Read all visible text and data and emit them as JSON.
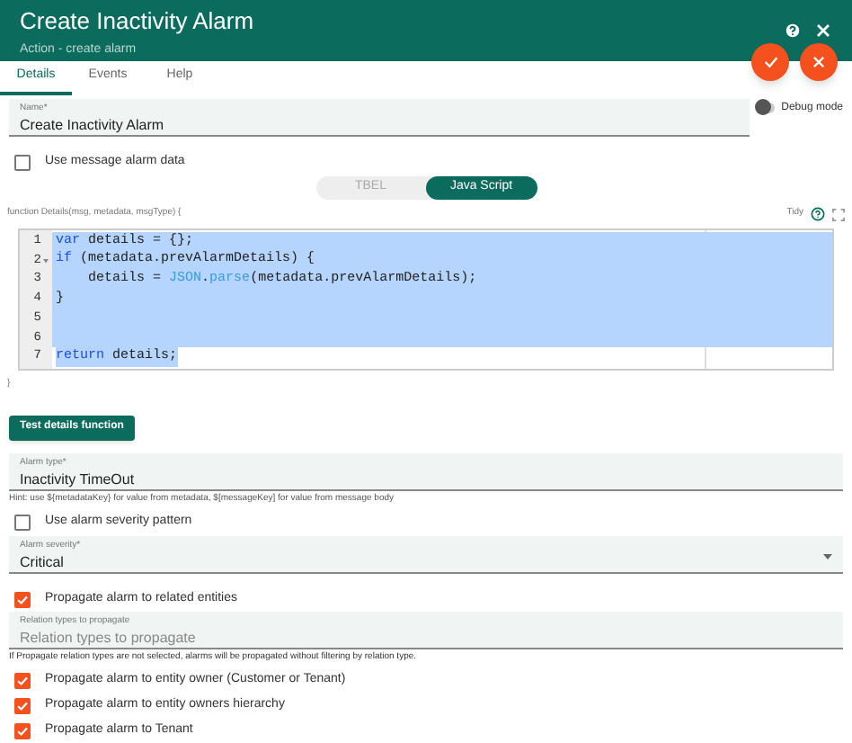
{
  "header": {
    "title": "Create Inactivity Alarm",
    "subtitle": "Action - create alarm"
  },
  "tabs": [
    {
      "label": "Details",
      "selected": true
    },
    {
      "label": "Events",
      "selected": false
    },
    {
      "label": "Help",
      "selected": false
    }
  ],
  "name_field": {
    "label": "Name*",
    "value": "Create Inactivity Alarm"
  },
  "debug_mode": {
    "label": "Debug mode",
    "on": false
  },
  "use_message_alarm_data": {
    "label": "Use message alarm data",
    "checked": false
  },
  "language_toggle": [
    {
      "label": "TBEL",
      "selected": false
    },
    {
      "label": "Java Script",
      "selected": true
    }
  ],
  "function_header": {
    "signature": "function Details(msg, metadata, msgType) {",
    "tidy": "Tidy"
  },
  "code_lines": [
    {
      "number": "1",
      "fold": false,
      "full_line_selected": true,
      "tokens": [
        {
          "text": "var",
          "kind": "keyword"
        },
        {
          "text": " details = {};",
          "kind": "plain"
        }
      ]
    },
    {
      "number": "2",
      "fold": true,
      "full_line_selected": true,
      "tokens": [
        {
          "text": "if",
          "kind": "keyword"
        },
        {
          "text": " (metadata.prevAlarmDetails) {",
          "kind": "plain"
        }
      ]
    },
    {
      "number": "3",
      "fold": false,
      "full_line_selected": true,
      "tokens": [
        {
          "text": "    details = ",
          "kind": "plain"
        },
        {
          "text": "JSON",
          "kind": "builtin"
        },
        {
          "text": ".",
          "kind": "plain"
        },
        {
          "text": "parse",
          "kind": "builtin"
        },
        {
          "text": "(metadata.prevAlarmDetails);",
          "kind": "plain"
        }
      ]
    },
    {
      "number": "4",
      "fold": false,
      "full_line_selected": true,
      "tokens": [
        {
          "text": "}",
          "kind": "plain"
        }
      ]
    },
    {
      "number": "5",
      "fold": false,
      "full_line_selected": true
    },
    {
      "number": "6",
      "fold": false,
      "full_line_selected": true
    },
    {
      "number": "7",
      "fold": false,
      "full_line_selected": false,
      "tokens": [
        {
          "text": "return",
          "kind": "keyword"
        },
        {
          "text": " details;",
          "kind": "plain"
        }
      ]
    }
  ],
  "function_footer": "}",
  "test_button": "Test details function",
  "alarm_type_field": {
    "label": "Alarm type*",
    "value": "Inactivity TimeOut"
  },
  "alarm_type_hint": "Hint: use ${metadataKey} for value from metadata, $[messageKey] for value from message body",
  "use_alarm_severity_pattern": {
    "label": "Use alarm severity pattern",
    "checked": false
  },
  "alarm_severity_field": {
    "label": "Alarm severity*",
    "value": "Critical"
  },
  "propagate_related": {
    "label": "Propagate alarm to related entities",
    "checked": true
  },
  "relation_types_field": {
    "label": "Relation types to propagate",
    "placeholder": "Relation types to propagate"
  },
  "relation_types_hint": "If Propagate relation types are not selected, alarms will be propagated without filtering by relation type.",
  "propagate_options": [
    {
      "label": "Propagate alarm to entity owner (Customer or Tenant)",
      "checked": true
    },
    {
      "label": "Propagate alarm to entity owners hierarchy",
      "checked": true
    },
    {
      "label": "Propagate alarm to Tenant",
      "checked": true
    }
  ]
}
